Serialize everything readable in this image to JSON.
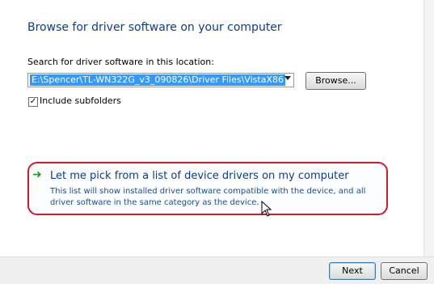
{
  "page": {
    "title": "Browse for driver software on your computer",
    "search_label": "Search for driver software in this location:",
    "path_value": "E:\\Spencer\\TL-WN322G_v3_090826\\Driver Files\\VistaX86",
    "browse_label": "Browse...",
    "include_subfolders_label": "Include subfolders",
    "include_subfolders_checked": true
  },
  "option": {
    "title": "Let me pick from a list of device drivers on my computer",
    "description": "This list will show installed driver software compatible with the device, and all driver software in the same category as the device."
  },
  "footer": {
    "next_label": "Next",
    "cancel_label": "Cancel"
  },
  "icons": {
    "option_arrow": "green-arrow-icon",
    "cursor": "mouse-cursor-icon"
  },
  "colors": {
    "highlight_border": "#d11a2a",
    "link_blue": "#0d3c8c",
    "selection_blue": "#3399ff"
  }
}
